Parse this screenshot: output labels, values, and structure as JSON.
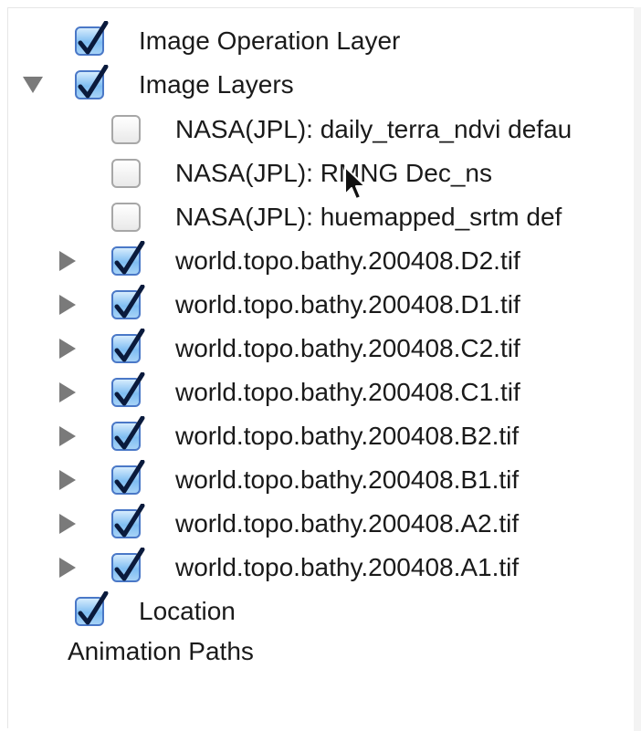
{
  "tree": {
    "items": [
      {
        "label": "Image Operation Layer",
        "checked": true,
        "expander": "none"
      },
      {
        "label": "Image Layers",
        "checked": true,
        "expander": "expanded"
      },
      {
        "label": "NASA(JPL): daily_terra_ndvi defau",
        "checked": false,
        "expander": "none"
      },
      {
        "label": "NASA(JPL): RMNG Dec_ns",
        "checked": false,
        "expander": "none"
      },
      {
        "label": "NASA(JPL): huemapped_srtm def",
        "checked": false,
        "expander": "none"
      },
      {
        "label": "world.topo.bathy.200408.D2.tif",
        "checked": true,
        "expander": "collapsed"
      },
      {
        "label": "world.topo.bathy.200408.D1.tif",
        "checked": true,
        "expander": "collapsed"
      },
      {
        "label": "world.topo.bathy.200408.C2.tif",
        "checked": true,
        "expander": "collapsed"
      },
      {
        "label": "world.topo.bathy.200408.C1.tif",
        "checked": true,
        "expander": "collapsed"
      },
      {
        "label": "world.topo.bathy.200408.B2.tif",
        "checked": true,
        "expander": "collapsed"
      },
      {
        "label": "world.topo.bathy.200408.B1.tif",
        "checked": true,
        "expander": "collapsed"
      },
      {
        "label": "world.topo.bathy.200408.A2.tif",
        "checked": true,
        "expander": "collapsed"
      },
      {
        "label": "world.topo.bathy.200408.A1.tif",
        "checked": true,
        "expander": "collapsed"
      },
      {
        "label": "Location",
        "checked": true,
        "expander": "none"
      },
      {
        "label": "Animation Paths",
        "checked": null,
        "expander": "none"
      }
    ]
  },
  "colors": {
    "check_blue": "#4a78c7",
    "check_mark": "#0a1a3c",
    "text": "#1a1a1a",
    "triangle": "#7a7a7a"
  }
}
